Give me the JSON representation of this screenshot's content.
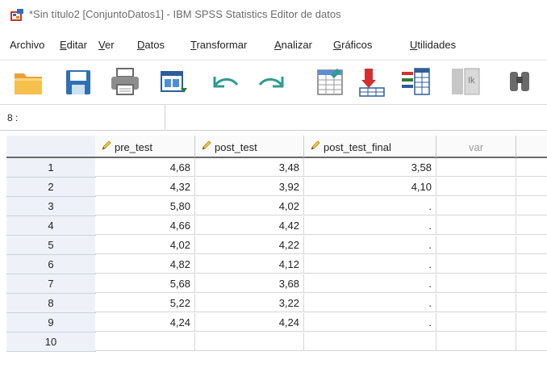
{
  "window": {
    "title": "*Sin título2 [ConjuntoDatos1] - IBM SPSS Statistics Editor de datos",
    "icon": "spss-app-icon"
  },
  "menu": [
    {
      "label": "Archivo",
      "hotkey_index": -1
    },
    {
      "label": "Editar",
      "hotkey_index": 0
    },
    {
      "label": "Ver",
      "hotkey_index": 0
    },
    {
      "label": "Datos",
      "hotkey_index": 0
    },
    {
      "label": "Transformar",
      "hotkey_index": 0
    },
    {
      "label": "Analizar",
      "hotkey_index": 0
    },
    {
      "label": "Gráficos",
      "hotkey_index": 0
    },
    {
      "label": "Utilidades",
      "hotkey_index": 0
    }
  ],
  "toolbar": [
    {
      "name": "open-folder-icon"
    },
    {
      "name": "save-icon"
    },
    {
      "name": "print-icon"
    },
    {
      "name": "dialog-recall-icon"
    },
    {
      "name": "undo-icon"
    },
    {
      "name": "redo-icon"
    },
    {
      "name": "goto-case-icon"
    },
    {
      "name": "goto-variable-icon"
    },
    {
      "name": "variables-icon"
    },
    {
      "name": "value-labels-icon"
    },
    {
      "name": "find-icon"
    }
  ],
  "cell_editor": {
    "reference": "8 :",
    "value": ""
  },
  "grid": {
    "columns": [
      {
        "label": "pre_test",
        "type": "scale"
      },
      {
        "label": "post_test",
        "type": "scale"
      },
      {
        "label": "post_test_final",
        "type": "scale"
      },
      {
        "label": "var",
        "type": "empty"
      },
      {
        "label": "",
        "type": "empty"
      }
    ],
    "rows": [
      {
        "n": "1",
        "cells": [
          "4,68",
          "3,48",
          "3,58",
          "",
          ""
        ]
      },
      {
        "n": "2",
        "cells": [
          "4,32",
          "3,92",
          "4,10",
          "",
          ""
        ]
      },
      {
        "n": "3",
        "cells": [
          "5,80",
          "4,02",
          ".",
          "",
          ""
        ]
      },
      {
        "n": "4",
        "cells": [
          "4,66",
          "4,42",
          ".",
          "",
          ""
        ]
      },
      {
        "n": "5",
        "cells": [
          "4,02",
          "4,22",
          ".",
          "",
          ""
        ]
      },
      {
        "n": "6",
        "cells": [
          "4,82",
          "4,12",
          ".",
          "",
          ""
        ]
      },
      {
        "n": "7",
        "cells": [
          "5,68",
          "3,68",
          ".",
          "",
          ""
        ]
      },
      {
        "n": "8",
        "cells": [
          "5,22",
          "3,22",
          ".",
          "",
          ""
        ]
      },
      {
        "n": "9",
        "cells": [
          "4,24",
          "4,24",
          ".",
          "",
          ""
        ]
      },
      {
        "n": "10",
        "cells": [
          "",
          "",
          "",
          "",
          ""
        ]
      }
    ]
  }
}
